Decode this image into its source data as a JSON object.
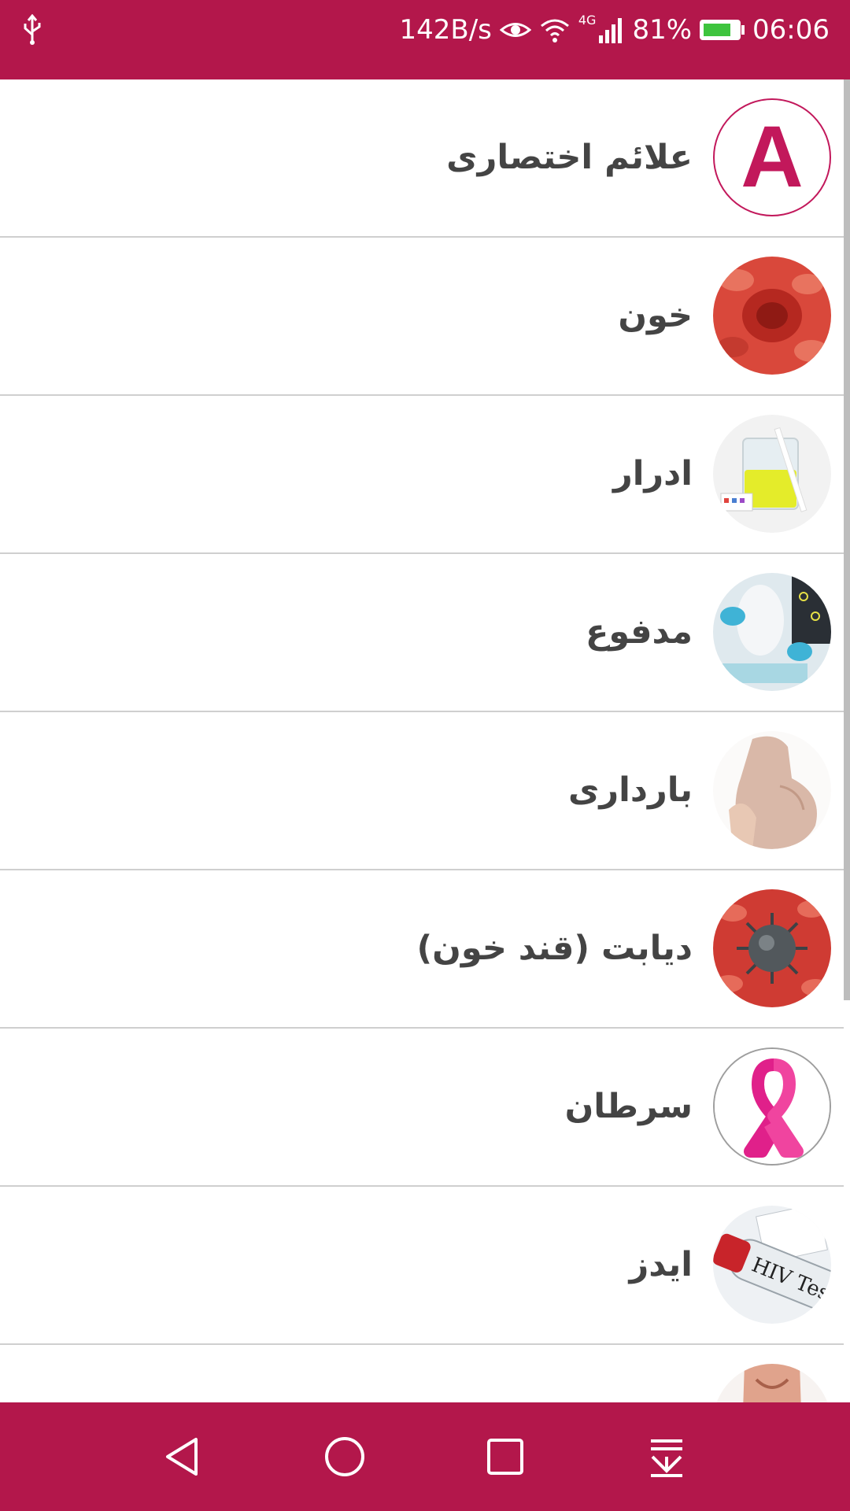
{
  "status_bar": {
    "network_speed": "142B/s",
    "network_type": "4G",
    "battery_percent": "81%",
    "battery_level": 0.81,
    "time": "06:06",
    "icons": [
      "usb-icon",
      "eye-icon",
      "wifi-icon",
      "signal-icon",
      "battery-icon"
    ]
  },
  "list": {
    "items": [
      {
        "label": "علائم اختصاری",
        "thumb": "letter",
        "thumb_text": "A",
        "icon": "abbreviations-icon"
      },
      {
        "label": "خون",
        "thumb": "image",
        "icon": "blood-cells-image"
      },
      {
        "label": "ادرار",
        "thumb": "image",
        "icon": "urine-test-image"
      },
      {
        "label": "مدفوع",
        "thumb": "image",
        "icon": "lab-test-image"
      },
      {
        "label": "بارداری",
        "thumb": "image",
        "icon": "pregnancy-image"
      },
      {
        "label": "دیابت (قند خون)",
        "thumb": "image",
        "icon": "virus-cells-image"
      },
      {
        "label": "سرطان",
        "thumb": "image",
        "icon": "pink-ribbon-image"
      },
      {
        "label": "ایدز",
        "thumb": "image",
        "icon": "hiv-test-tube-image",
        "thumb_text": "HIV Tes"
      },
      {
        "label": "",
        "thumb": "image",
        "icon": "partial-item-image"
      }
    ]
  },
  "nav_bar": {
    "buttons": [
      "back-icon",
      "home-icon",
      "recents-icon",
      "notification-pull-icon"
    ]
  },
  "colors": {
    "brand": "#b3174b",
    "accent": "#c2185b",
    "label": "#444444",
    "divider": "#cfcfcf"
  }
}
